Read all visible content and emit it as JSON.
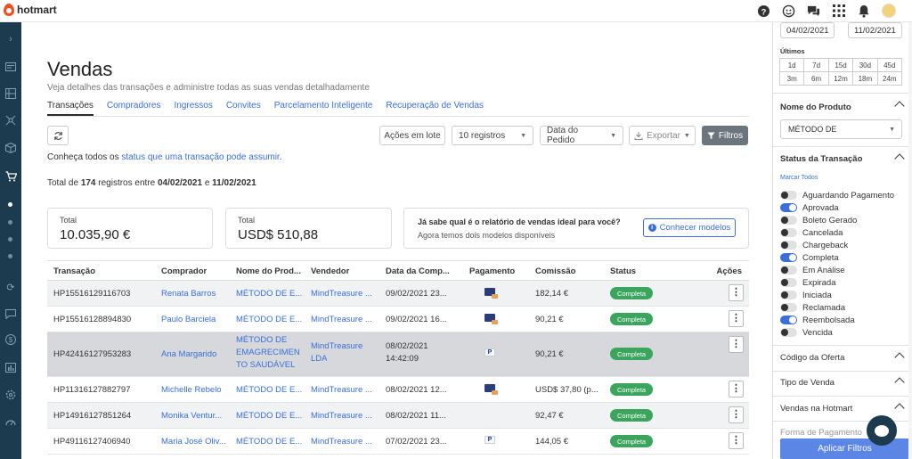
{
  "brand": {
    "name": "hotmart"
  },
  "topbar": {
    "icons": [
      "help-icon",
      "smiley-icon",
      "chat-icon",
      "apps-grid-icon",
      "bell-icon"
    ]
  },
  "page": {
    "title": "Vendas",
    "subtitle": "Veja detalhes das transações e administre todas as suas vendas detalhadamente"
  },
  "tabs": [
    {
      "label": "Transações",
      "active": true
    },
    {
      "label": "Compradores",
      "active": false
    },
    {
      "label": "Ingressos",
      "active": false
    },
    {
      "label": "Convites",
      "active": false
    },
    {
      "label": "Parcelamento Inteligente",
      "active": false
    },
    {
      "label": "Recuperação de Vendas",
      "active": false
    }
  ],
  "toolbar": {
    "batch_label": "Ações em lote",
    "records_label": "10 registros",
    "date_label": "Data do Pedido",
    "export_label": "Exportar",
    "filters_label": "Filtros"
  },
  "status_note": {
    "prefix": "Conheça todos os ",
    "link": "status que uma transação pode assumir",
    "suffix": "."
  },
  "total_line": {
    "prefix": "Total de ",
    "count": "174",
    "middle": " registros entre ",
    "start": "04/02/2021",
    "and": " e ",
    "end": "11/02/2021"
  },
  "cards": {
    "total_brl": {
      "label": "Total",
      "value": "10.035,90 €"
    },
    "total_usd": {
      "label": "Total",
      "value": "USD$ 510,88"
    },
    "promo": {
      "question": "Já sabe qual é o relatório de vendas ideal para você?",
      "answer": "Agora temos dois modelos disponíveis",
      "button": "Conhecer modelos"
    }
  },
  "table": {
    "headers": [
      "Transação",
      "Comprador",
      "Nome do Prod...",
      "Vendedor",
      "Data da Comp...",
      "Pagamento",
      "Comissão",
      "Status",
      "Ações"
    ],
    "rows": [
      {
        "id": "HP15516129116703",
        "buyer": "Renata Barros",
        "product": "MÉTODO DE E...",
        "seller": "MindTreasure ...",
        "date": "09/02/2021 23...",
        "payment": "card",
        "commission": "182,14 €",
        "status": "Completa"
      },
      {
        "id": "HP15516128894830",
        "buyer": "Paulo Barciela",
        "product": "MÉTODO DE E...",
        "seller": "MindTreasure ...",
        "date": "09/02/2021 16...",
        "payment": "card",
        "commission": "90,21 €",
        "status": "Completa"
      },
      {
        "id": "HP42416127953283",
        "buyer": "Ana Margarido",
        "product_lines": [
          "MÉTODO DE",
          "EMAGRECIMEN",
          "TO SAUDÁVEL"
        ],
        "seller_lines": [
          "MindTreasure",
          "LDA"
        ],
        "date_lines": [
          "08/02/2021",
          "14:42:09"
        ],
        "payment": "paypal",
        "commission": "90,21 €",
        "status": "Completa"
      },
      {
        "id": "HP11316127882797",
        "buyer": "Michelle Rebelo",
        "product": "MÉTODO DE E...",
        "seller": "MindTreasure ...",
        "date": "08/02/2021 12...",
        "payment": "card",
        "commission": "USD$ 37,80 (p...",
        "status": "Completa"
      },
      {
        "id": "HP14916127851264",
        "buyer": "Monika Ventur...",
        "product": "MÉTODO DE E...",
        "seller": "MindTreasure ...",
        "date": "08/02/2021 11...",
        "payment": "none",
        "commission": "92,47 €",
        "status": "Completa"
      },
      {
        "id": "HP49116127406940",
        "buyer": "Maria José Oliv...",
        "product": "MÉTODO DE E...",
        "seller": "MindTreasure ...",
        "date": "07/02/2021 23...",
        "payment": "paypal",
        "commission": "144,05 €",
        "status": "Completa"
      }
    ]
  },
  "panel": {
    "date_start": "04/02/2021",
    "date_end": "11/02/2021",
    "ultimos_label": "Últimos",
    "ranges": [
      "1d",
      "7d",
      "15d",
      "30d",
      "45d",
      "3m",
      "6m",
      "12m",
      "18m",
      "24m"
    ],
    "product_section": "Nome do Produto",
    "product_value": "MÉTODO DE",
    "status_section": "Status da Transação",
    "mark_all": "Marcar Todos",
    "statuses": [
      {
        "label": "Aguardando Pagamento",
        "on": false
      },
      {
        "label": "Aprovada",
        "on": true
      },
      {
        "label": "Boleto Gerado",
        "on": false
      },
      {
        "label": "Cancelada",
        "on": false
      },
      {
        "label": "Chargeback",
        "on": false
      },
      {
        "label": "Completa",
        "on": true
      },
      {
        "label": "Em Análise",
        "on": false
      },
      {
        "label": "Expirada",
        "on": false
      },
      {
        "label": "Iniciada",
        "on": false
      },
      {
        "label": "Reclamada",
        "on": false
      },
      {
        "label": "Reembolsada",
        "on": true
      },
      {
        "label": "Vencida",
        "on": false
      }
    ],
    "offer_code": "Código da Oferta",
    "sale_type": "Tipo de Venda",
    "hotmart_sales": "Vendas na Hotmart",
    "cut_section": "Forma de Pagamento",
    "apply_label": "Aplicar Filtros"
  },
  "colors": {
    "accent": "#3a6fd8",
    "sidebar": "#1d3b4f",
    "success": "#3ba55d",
    "brand": "#f04e23"
  }
}
